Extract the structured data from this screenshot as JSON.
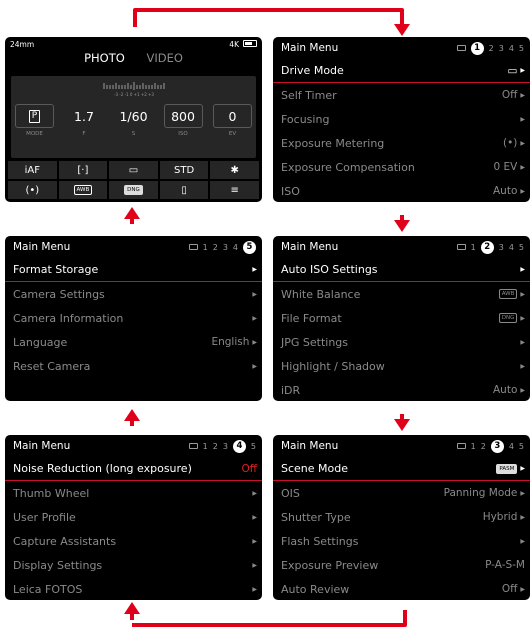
{
  "colors": {
    "accent_red": "#c8102e",
    "arrow_red": "#e1001a",
    "screen_bg": "#000000",
    "dim_text": "#8a8a8a"
  },
  "photo_screen": {
    "focal": "24mm",
    "resolution": "4K",
    "mode_photo": "PHOTO",
    "mode_video": "VIDEO",
    "ev_scale": "-3 -2 -1  0 +1 +2 +3",
    "params": [
      {
        "value": "P",
        "label": "MODE"
      },
      {
        "value": "1.7",
        "label": "F"
      },
      {
        "value": "1/60",
        "label": "S"
      },
      {
        "value": "800",
        "label": "ISO"
      },
      {
        "value": "0",
        "label": "EV"
      }
    ],
    "grid": [
      {
        "text": "iAF",
        "icon": "af-mode-icon"
      },
      {
        "text": "[·]",
        "icon": "focus-field-icon"
      },
      {
        "text": "▭",
        "icon": "drive-mode-icon"
      },
      {
        "text": "STD",
        "icon": "film-style-icon"
      },
      {
        "text": "✱",
        "icon": "sensor-icon"
      },
      {
        "text": "(•)",
        "icon": "metering-icon"
      },
      {
        "text": "AWB",
        "icon": "white-balance-icon"
      },
      {
        "text": "DNG",
        "icon": "file-format-icon"
      },
      {
        "text": "▯",
        "icon": "phone-icon"
      },
      {
        "text": "≡",
        "icon": "menu-icon"
      }
    ]
  },
  "menus": {
    "title": "Main Menu",
    "page1": {
      "rows": [
        {
          "label": "Drive Mode",
          "value": "▭"
        },
        {
          "label": "Self Timer",
          "value": "Off"
        },
        {
          "label": "Focusing",
          "value": ""
        },
        {
          "label": "Exposure Metering",
          "value": "(•)"
        },
        {
          "label": "Exposure Compensation",
          "value": "0 EV"
        },
        {
          "label": "ISO",
          "value": "Auto"
        }
      ]
    },
    "page2": {
      "rows": [
        {
          "label": "Auto ISO Settings",
          "value": ""
        },
        {
          "label": "White Balance",
          "value": "AWB"
        },
        {
          "label": "File Format",
          "value": "DNG"
        },
        {
          "label": "JPG Settings",
          "value": ""
        },
        {
          "label": "Highlight / Shadow",
          "value": ""
        },
        {
          "label": "iDR",
          "value": "Auto"
        }
      ]
    },
    "page3": {
      "rows": [
        {
          "label": "Scene Mode",
          "value": "PASM"
        },
        {
          "label": "OIS",
          "value": "Panning Mode"
        },
        {
          "label": "Shutter Type",
          "value": "Hybrid"
        },
        {
          "label": "Flash Settings",
          "value": ""
        },
        {
          "label": "Exposure Preview",
          "value": "P-A-S-M"
        },
        {
          "label": "Auto Review",
          "value": "Off"
        }
      ]
    },
    "page4": {
      "rows": [
        {
          "label": "Noise Reduction (long exposure)",
          "value": "Off"
        },
        {
          "label": "Thumb Wheel",
          "value": ""
        },
        {
          "label": "User Profile",
          "value": ""
        },
        {
          "label": "Capture Assistants",
          "value": ""
        },
        {
          "label": "Display Settings",
          "value": ""
        },
        {
          "label": "Leica FOTOS",
          "value": ""
        }
      ]
    },
    "page5": {
      "rows": [
        {
          "label": "Format Storage",
          "value": ""
        },
        {
          "label": "Camera Settings",
          "value": ""
        },
        {
          "label": "Camera Information",
          "value": ""
        },
        {
          "label": "Language",
          "value": "English"
        },
        {
          "label": "Reset Camera",
          "value": ""
        }
      ]
    },
    "page_numbers": [
      "1",
      "2",
      "3",
      "4",
      "5"
    ]
  }
}
